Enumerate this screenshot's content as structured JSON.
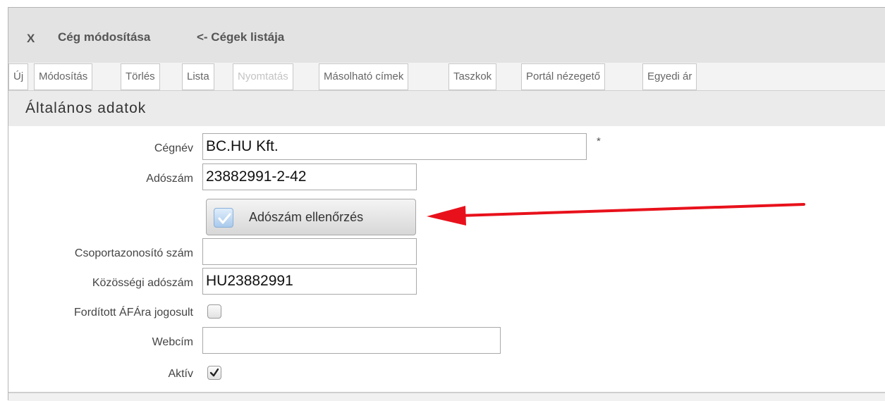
{
  "window": {
    "close_label": "X",
    "title": "Cég módosítása",
    "back_link": "<- Cégek listája"
  },
  "toolbar": {
    "tabs": [
      {
        "label": "Új",
        "enabled": true
      },
      {
        "label": "Módosítás",
        "enabled": true
      },
      {
        "label": "Törlés",
        "enabled": true
      },
      {
        "label": "Lista",
        "enabled": true
      },
      {
        "label": "Nyomtatás",
        "enabled": false
      },
      {
        "label": "Másolható címek",
        "enabled": true
      },
      {
        "label": "Taszkok",
        "enabled": true
      },
      {
        "label": "Portál nézegető",
        "enabled": true
      },
      {
        "label": "Egyedi ár",
        "enabled": true
      }
    ]
  },
  "section": {
    "title": "Általános adatok"
  },
  "form": {
    "company_name": {
      "label": "Cégnév",
      "value": "BC.HU Kft.",
      "required_mark": "*"
    },
    "tax_number": {
      "label": "Adószám",
      "value": "23882991-2-42"
    },
    "check_button": {
      "label": "Adószám ellenőrzés",
      "icon": "check-icon"
    },
    "group_id": {
      "label": "Csoportazonosító szám",
      "value": ""
    },
    "eu_tax_number": {
      "label": "Közösségi adószám",
      "value": "HU23882991"
    },
    "reverse_vat": {
      "label": "Fordított ÁFÁra jogosult",
      "checked": false
    },
    "website": {
      "label": "Webcím",
      "value": ""
    },
    "active": {
      "label": "Aktív",
      "checked": true
    }
  },
  "annotation": {
    "arrow_color": "#e8111b"
  }
}
